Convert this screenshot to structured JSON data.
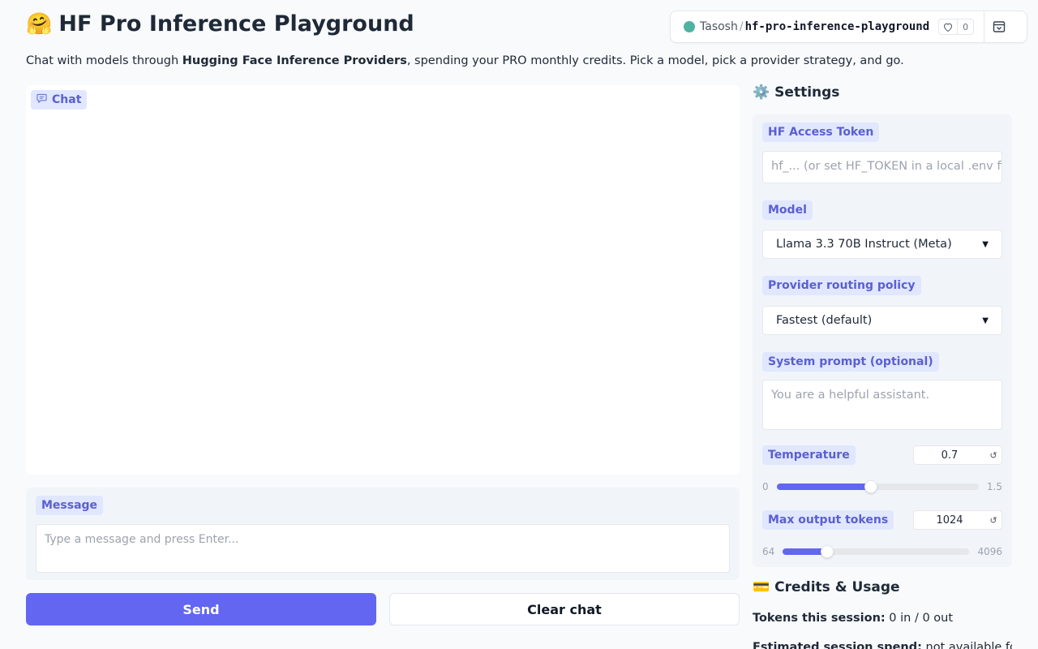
{
  "header": {
    "emoji": "🤗",
    "title": "HF Pro Inference Playground",
    "subtitle_before": "Chat with models through ",
    "subtitle_bold": "Hugging Face Inference Providers",
    "subtitle_after": ", spending your PRO monthly credits. Pick a model, pick a provider strategy, and go."
  },
  "space_badge": {
    "owner": "Tasosh",
    "separator": "/",
    "repo": "hf-pro-inference-playground",
    "likes": "0"
  },
  "chat": {
    "label": "Chat"
  },
  "message": {
    "label": "Message",
    "placeholder": "Type a message and press Enter..."
  },
  "buttons": {
    "send": "Send",
    "clear": "Clear chat"
  },
  "settings": {
    "heading_icon": "⚙️",
    "heading": "Settings",
    "token": {
      "label": "HF Access Token",
      "placeholder": "hf_... (or set HF_TOKEN in a local .env file)"
    },
    "model": {
      "label": "Model",
      "value": "Llama 3.3 70B Instruct (Meta)"
    },
    "routing": {
      "label": "Provider routing policy",
      "value": "Fastest (default)"
    },
    "system_prompt": {
      "label": "System prompt (optional)",
      "placeholder": "You are a helpful assistant."
    },
    "temperature": {
      "label": "Temperature",
      "value": "0.7",
      "min": "0",
      "max": "1.5",
      "fraction": 0.467
    },
    "max_tokens": {
      "label": "Max output tokens",
      "value": "1024",
      "min": "64",
      "max": "4096",
      "fraction": 0.238
    }
  },
  "credits": {
    "heading_icon": "💳",
    "heading": "Credits & Usage",
    "tokens_label": "Tokens this session:",
    "tokens_value": " 0 in / 0 out",
    "spend_label": "Estimated session spend:",
    "spend_value": " not available for"
  },
  "colors": {
    "accent": "#6366f1",
    "chip_bg": "#e0e7ff",
    "chip_text": "#5b5fcf",
    "status_dot": "#4fb3a2"
  }
}
